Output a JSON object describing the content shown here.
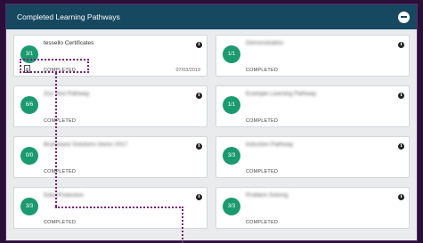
{
  "header": {
    "title": "Completed Learning Pathways"
  },
  "cards": [
    {
      "progress": "3/1",
      "title": "tessello Certificates",
      "status": "COMPLETED",
      "date": "07/03/2019",
      "blurred": false
    },
    {
      "progress": "1/1",
      "title": "Demonstration",
      "status": "COMPLETED",
      "date": "",
      "blurred": true
    },
    {
      "progress": "6/6",
      "title": "Zoo Test Pathway",
      "status": "COMPLETED",
      "date": "",
      "blurred": true
    },
    {
      "progress": "1/1",
      "title": "Example Learning Pathway",
      "status": "COMPLETED",
      "date": "",
      "blurred": true
    },
    {
      "progress": "0/0",
      "title": "Brainwave Solutions Demo 2017",
      "status": "COMPLETED",
      "date": "",
      "blurred": true
    },
    {
      "progress": "3/3",
      "title": "Induction Pathway",
      "status": "COMPLETED",
      "date": "",
      "blurred": true
    },
    {
      "progress": "3/3",
      "title": "Data Protection",
      "status": "COMPLETED",
      "date": "",
      "blurred": true
    },
    {
      "progress": "3/3",
      "title": "Problem Solving",
      "status": "COMPLETED",
      "date": "",
      "blurred": true
    }
  ],
  "info_icon_glyph": "i",
  "colors": {
    "header_bg": "#16485f",
    "progress_badge": "#1a9a6e",
    "annotation": "#7a1e7a"
  }
}
